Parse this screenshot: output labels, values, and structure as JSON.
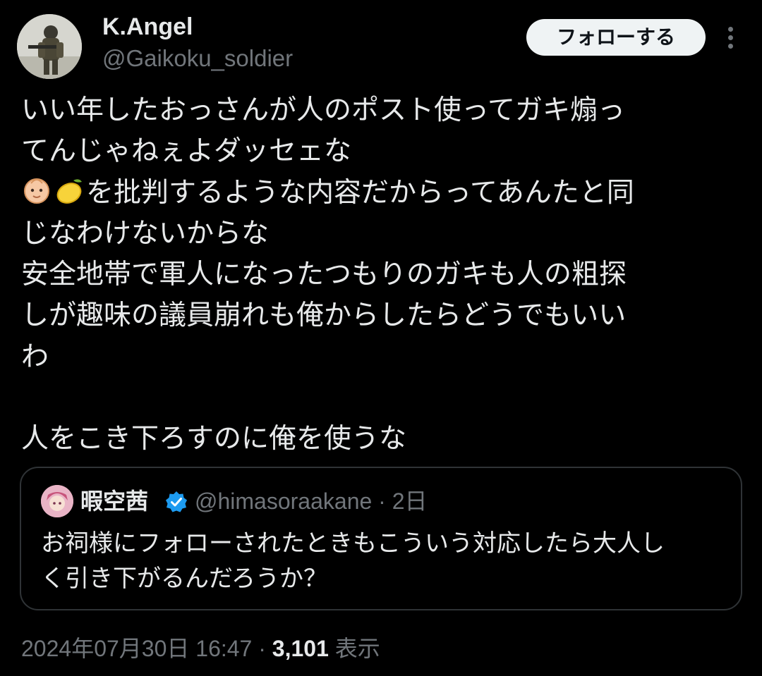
{
  "author": {
    "display_name": "K.Angel",
    "handle": "@Gaikoku_soldier",
    "avatar_icon": "soldier-avatar"
  },
  "actions": {
    "follow_label": "フォローする",
    "more_icon": "more-vertical-icon"
  },
  "tweet": {
    "lines": [
      "いい年したおっさんが人のポスト使ってガキ煽っ",
      "てんじゃねぇよダッセェな",
      "を批判するような内容だからってあんたと同",
      "じなわけないからな",
      "安全地帯で軍人になったつもりのガキも人の粗探",
      "しが趣味の議員崩れも俺からしたらどうでもいい",
      "わ",
      "人をこき下ろすのに俺を使うな"
    ],
    "emojis": [
      "baby-face-emoji",
      "lemon-emoji"
    ]
  },
  "quote": {
    "display_name": "暇空茜",
    "verified_icon": "verified-badge-icon",
    "handle": "@himasoraakane",
    "separator": "·",
    "age": "2日",
    "lines": [
      "お祠様にフォローされたときもこういう対応したら大人し",
      "く引き下がるんだろうか？"
    ]
  },
  "meta": {
    "timestamp": "2024年07月30日 16:47",
    "separator": "·",
    "views_count": "3,101",
    "views_label": "表示"
  },
  "colors": {
    "background": "#000000",
    "text_primary": "#e7e9ea",
    "text_secondary": "#71767b",
    "border": "#2f3336",
    "follow_bg": "#eff3f4",
    "verified": "#1d9bf0"
  }
}
